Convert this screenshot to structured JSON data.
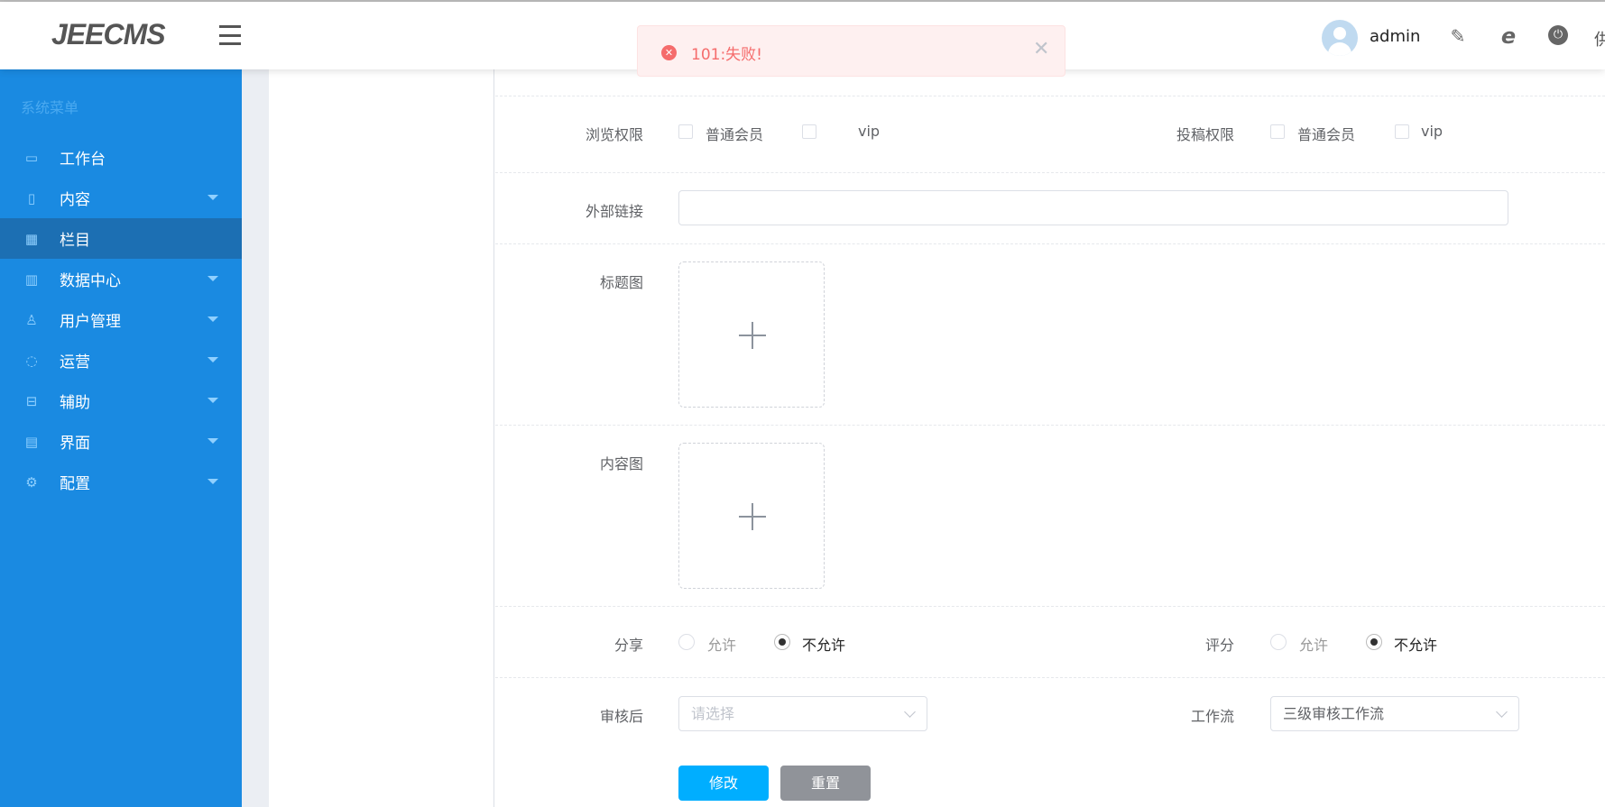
{
  "header": {
    "logo": "JEECMS",
    "user": "admin",
    "right_cut_text": "供",
    "icons": [
      "user-edit-icon",
      "ie-browser-icon",
      "power-icon"
    ]
  },
  "toast": {
    "type": "error",
    "message": "101:失败!",
    "color": "#f56c6c"
  },
  "sidebar": {
    "title": "系统菜单",
    "bg": "#1a8ae1",
    "items": [
      {
        "label": "工作台",
        "icon": "monitor-icon",
        "sub": false
      },
      {
        "label": "内容",
        "icon": "document-icon",
        "sub": true
      },
      {
        "label": "栏目",
        "icon": "grid-icon",
        "sub": false,
        "selected": true
      },
      {
        "label": "数据中心",
        "icon": "bar-chart-icon",
        "sub": true
      },
      {
        "label": "用户管理",
        "icon": "user-icon",
        "sub": true
      },
      {
        "label": "运营",
        "icon": "cycle-icon",
        "sub": true
      },
      {
        "label": "辅助",
        "icon": "toolbox-icon",
        "sub": true
      },
      {
        "label": "界面",
        "icon": "layout-icon",
        "sub": true
      },
      {
        "label": "配置",
        "icon": "gear-icon",
        "sub": true
      }
    ]
  },
  "form": {
    "browse": {
      "label": "浏览权限",
      "options": [
        "普通会员",
        "vip"
      ]
    },
    "submit": {
      "label": "投稿权限",
      "options": [
        "普通会员",
        "vip"
      ]
    },
    "external_link": {
      "label": "外部链接",
      "value": ""
    },
    "title_image": {
      "label": "标题图"
    },
    "content_image": {
      "label": "内容图"
    },
    "share": {
      "label": "分享",
      "options": [
        "允许",
        "不允许"
      ],
      "selected": "不允许"
    },
    "rating": {
      "label": "评分",
      "options": [
        "允许",
        "不允许"
      ],
      "selected": "不允许"
    },
    "after_review": {
      "label": "审核后",
      "placeholder": "请选择"
    },
    "workflow": {
      "label": "工作流",
      "value": "三级审核工作流"
    },
    "submit_button": "修改",
    "reset_button": "重置"
  }
}
